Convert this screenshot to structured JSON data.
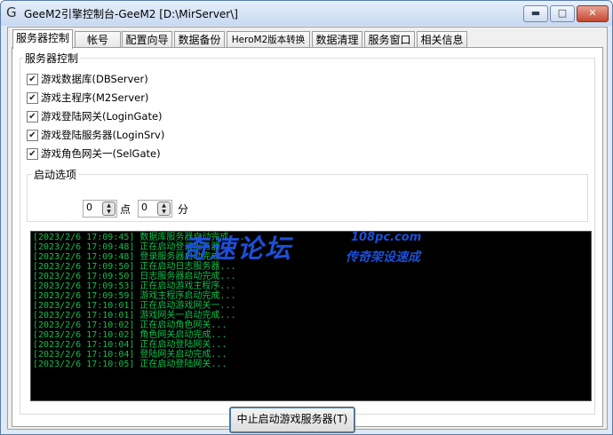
{
  "window": {
    "title": "GeeM2引擎控制台-GeeM2 [D:\\MirServer\\]",
    "icon": "g-icon",
    "minimize": "▬",
    "maximize": "□",
    "close": "✕"
  },
  "tabs": [
    {
      "label": "服务器控制",
      "active": true
    },
    {
      "label": "帐号"
    },
    {
      "label": "配置向导"
    },
    {
      "label": "数据备份"
    },
    {
      "label": "HeroM2版本转换"
    },
    {
      "label": "数据清理"
    },
    {
      "label": "服务窗口"
    },
    {
      "label": "相关信息"
    }
  ],
  "server_group": {
    "title": "服务器控制",
    "items": [
      {
        "label": "游戏数据库(DBServer)",
        "checked": true
      },
      {
        "label": "游戏主程序(M2Server)",
        "checked": true
      },
      {
        "label": "游戏登陆网关(LoginGate)",
        "checked": true
      },
      {
        "label": "游戏登陆服务器(LoginSrv)",
        "checked": true
      },
      {
        "label": "游戏角色网关一(SelGate)",
        "checked": true
      }
    ]
  },
  "start_options": {
    "title": "启动选项",
    "hour_value": "0",
    "hour_unit": "点",
    "minute_value": "0",
    "minute_unit": "分"
  },
  "log": [
    "[2023/2/6 17:09:45] 数据库服务器启动完成...",
    "[2023/2/6 17:09:48] 正在启动登录服务器...",
    "[2023/2/6 17:09:48] 登录服务器启动完成...",
    "[2023/2/6 17:09:50] 正在启动日志服务器...",
    "[2023/2/6 17:09:50] 日志服务器启动完成...",
    "[2023/2/6 17:09:53] 正在启动游戏主程序...",
    "[2023/2/6 17:09:59] 游戏主程序启动完成...",
    "[2023/2/6 17:10:01] 正在启动游戏网关一...",
    "[2023/2/6 17:10:01] 游戏网关一启动完成...",
    "[2023/2/6 17:10:02] 正在启动角色网关...",
    "[2023/2/6 17:10:02] 角色网关启动完成...",
    "[2023/2/6 17:10:04] 正在启动登陆网关...",
    "[2023/2/6 17:10:04] 登陆网关启动完成...",
    "[2023/2/6 17:10:05] 正在启动登陆网关..."
  ],
  "watermark": {
    "big": "奇速论坛",
    "site": "108pc.com",
    "slogan": "传奇架设速成"
  },
  "stop_button": "中止启动游戏服务器(T)",
  "colors": {
    "log_text": "#10c04a",
    "log_bg": "#000000",
    "watermark": "#1c4fd8"
  }
}
